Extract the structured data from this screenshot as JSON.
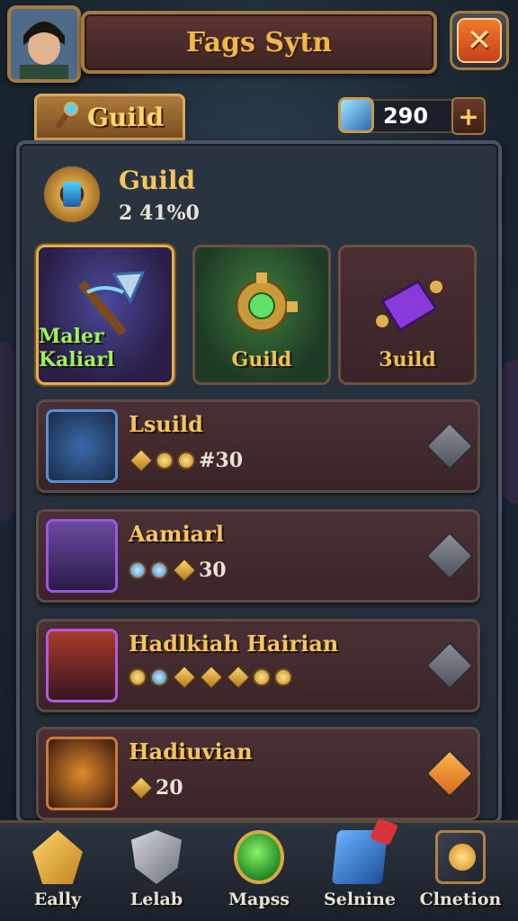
{
  "header": {
    "title": "Fags Sytn",
    "close_symbol": "✕"
  },
  "tab": {
    "label": "Guild"
  },
  "currency": {
    "amount": "290",
    "plus_symbol": "+"
  },
  "guild": {
    "name": "Guild",
    "subtitle": "2 41%0"
  },
  "categories": [
    {
      "label": "Maler Kaliarl",
      "icon": "weapon-axe-icon"
    },
    {
      "label": "Guild",
      "icon": "guild-amulet-icon"
    },
    {
      "label": "3uild",
      "icon": "purple-scroll-icon"
    }
  ],
  "rows": [
    {
      "title": "Lsuild",
      "stats": "#30",
      "icon": "axe-icon"
    },
    {
      "title": "Aamiarl",
      "stats": "30",
      "icon": "hero-portrait-icon"
    },
    {
      "title": "Hadlkiah Hairian",
      "stats": "",
      "icon": "heroine-portrait-icon"
    },
    {
      "title": "Hadiuvian",
      "stats": "20",
      "icon": "warrior-portrait-icon"
    }
  ],
  "nav": [
    {
      "label": "Eally",
      "icon": "crystal-icon"
    },
    {
      "label": "Lelab",
      "icon": "shield-icon"
    },
    {
      "label": "Mapss",
      "icon": "map-orb-icon"
    },
    {
      "label": "Selnine",
      "icon": "gem-cube-icon"
    },
    {
      "label": "Clnetion",
      "icon": "collection-icon"
    }
  ],
  "colors": {
    "gold": "#f4c55a",
    "green_label": "#9bf25a",
    "panel": "#2a3441",
    "row": "#4a3034"
  }
}
